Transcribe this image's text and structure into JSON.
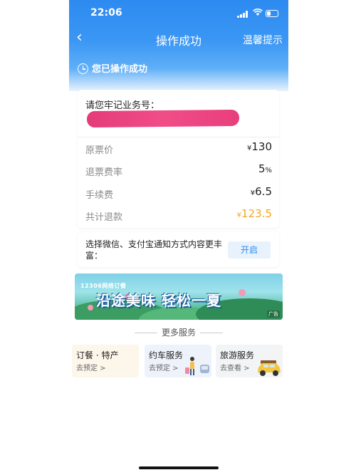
{
  "status_bar": {
    "time": "22:06"
  },
  "nav": {
    "title": "操作成功",
    "tip": "温馨提示"
  },
  "success": {
    "text": "您已操作成功"
  },
  "order_card": {
    "remember_label": "请您牢记业务号：",
    "rows": [
      {
        "label": "原票价",
        "currency": "¥",
        "value": "130"
      },
      {
        "label": "退票费率",
        "value": "5",
        "unit": "%"
      },
      {
        "label": "手续费",
        "currency": "¥",
        "value": "6.5"
      },
      {
        "label": "共计退款",
        "currency": "¥",
        "value": "123.5"
      }
    ]
  },
  "notification": {
    "text": "选择微信、支付宝通知方式内容更丰富：",
    "button": "开启"
  },
  "banner": {
    "brand": "12306网络订餐",
    "slogan": "沿途美味 轻松一夏",
    "ad_tag": "广告"
  },
  "more_services": {
    "title": "更多服务",
    "items": [
      {
        "title": "订餐 · 特产",
        "subtitle": "去预定 >"
      },
      {
        "title": "约车服务",
        "subtitle": "去预定 >"
      },
      {
        "title": "旅游服务",
        "subtitle": "去查看 >"
      }
    ]
  },
  "colors": {
    "primary_blue": "#2d8af0",
    "refund_orange": "#f5a623",
    "redaction": "#e63173"
  }
}
